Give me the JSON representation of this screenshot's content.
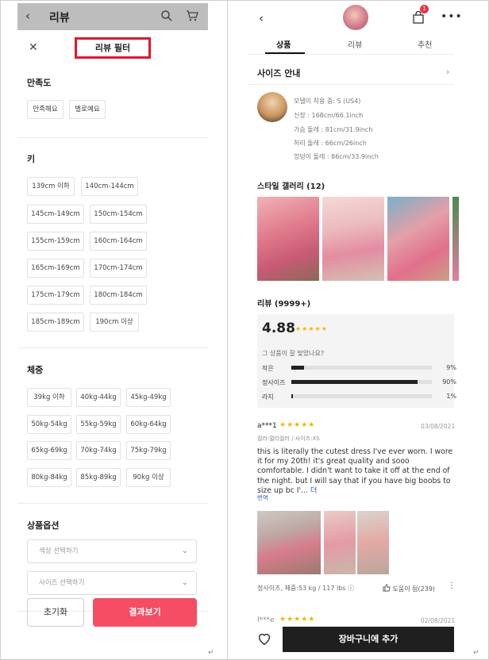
{
  "left": {
    "header": {
      "back": "‹",
      "title": "리뷰"
    },
    "sheet": {
      "close": "✕",
      "title": "리뷰 필터"
    },
    "satisfaction": {
      "title": "만족도",
      "options": [
        "만족해요",
        "별로예요"
      ]
    },
    "height": {
      "title": "키",
      "options": [
        "139cm 이하",
        "140cm-144cm",
        "145cm-149cm",
        "150cm-154cm",
        "155cm-159cm",
        "160cm-164cm",
        "165cm-169cm",
        "170cm-174cm",
        "175cm-179cm",
        "180cm-184cm",
        "185cm-189cm",
        "190cm 이상"
      ]
    },
    "weight": {
      "title": "체중",
      "options": [
        "39kg 이하",
        "40kg-44kg",
        "45kg-49kg",
        "50kg-54kg",
        "55kg-59kg",
        "60kg-64kg",
        "65kg-69kg",
        "70kg-74kg",
        "75kg-79kg",
        "80kg-84kg",
        "85kg-89kg",
        "90kg 이상"
      ]
    },
    "product_options": {
      "title": "상품옵션",
      "color_placeholder": "색상 선택하기",
      "size_placeholder": "사이즈 선택하기"
    },
    "buttons": {
      "reset": "초기화",
      "apply": "결과보기"
    }
  },
  "right": {
    "header": {
      "back": "‹",
      "cart_count": "1",
      "more": "•••"
    },
    "tabs": [
      "상품",
      "리뷰",
      "추천"
    ],
    "size_guide": {
      "label": "사이즈 안내",
      "arrow": "›"
    },
    "model": {
      "lines": [
        "모델이 착용 중: S (US4)",
        "신장 : 168cm/66.1inch",
        "가슴 둘레 : 81cm/31.9inch",
        "허리 둘레 : 66cm/26inch",
        "엉덩이 둘레 : 86cm/33.9inch"
      ]
    },
    "gallery": {
      "title": "스타일 갤러리 (12)"
    },
    "reviews": {
      "title": "리뷰 (9999+)",
      "rating": "4.88",
      "stars": "★★★★★",
      "fit_question": "그 상품이 잘 맞았나요?",
      "fit": [
        {
          "label": "작은",
          "pct": "9%",
          "value": 9
        },
        {
          "label": "정사이즈",
          "pct": "90%",
          "value": 90
        },
        {
          "label": "라지",
          "pct": "1%",
          "value": 1
        }
      ]
    },
    "review1": {
      "user": "a***1",
      "stars": "★★★★★",
      "date": "03/08/2021",
      "meta": "컬러:멀티컬러 / 사이즈:XS",
      "body": "this is literally the cutest dress I've ever worn. I wore it for my 20th! it's great quality and sooo comfortable. I didn't want to take it off at the end of the night. but I will say that if you have big boobs to size up bc I'...",
      "more": "더",
      "translate": "번역",
      "spec": "정사이즈, 체중:53 kg / 117 lbs",
      "help": "도움이 됨(239)",
      "kebab": "⋮"
    },
    "review2": {
      "user": "l***e",
      "stars": "★★★★★",
      "date": "02/08/2021"
    },
    "cart_button": "장바구니에 추가"
  },
  "colors": {
    "accent_red": "#e0182d",
    "apply_pink": "#f54d63",
    "star": "#f6b400",
    "cart_dark": "#1f1f1f"
  },
  "icons": [
    "back-icon",
    "search-icon",
    "cart-icon",
    "close-icon",
    "shopping-bag-icon",
    "more-icon",
    "chevron-right-icon",
    "chevron-down-icon",
    "star-icon",
    "thumbs-up-icon",
    "heart-icon"
  ]
}
